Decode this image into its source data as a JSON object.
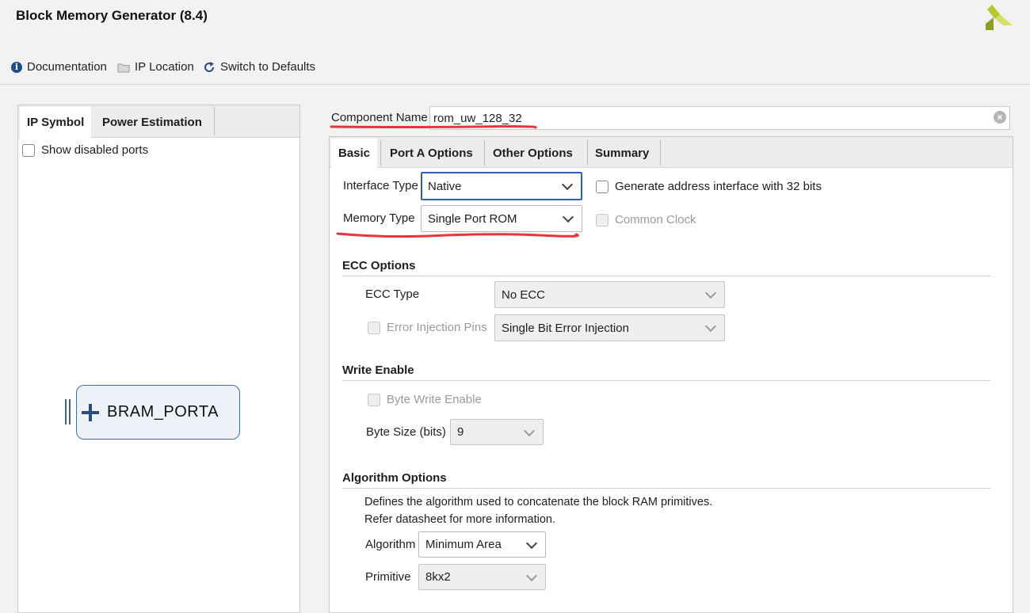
{
  "window": {
    "title": "Block Memory Generator (8.4)"
  },
  "toolbar": {
    "documentation": "Documentation",
    "ip_location": "IP Location",
    "switch_defaults": "Switch to Defaults"
  },
  "left_panel": {
    "tabs": [
      "IP Symbol",
      "Power Estimation"
    ],
    "show_disabled_ports": "Show disabled ports",
    "symbol_label": "BRAM_PORTA"
  },
  "component": {
    "label": "Component Name",
    "value": "rom_uw_128_32"
  },
  "right_tabs": [
    "Basic",
    "Port A Options",
    "Other Options",
    "Summary"
  ],
  "basic": {
    "interface_type_label": "Interface Type",
    "interface_type_value": "Native",
    "memory_type_label": "Memory Type",
    "memory_type_value": "Single Port ROM",
    "gen_addr_label": "Generate address interface with 32 bits",
    "common_clock_label": "Common Clock"
  },
  "ecc": {
    "title": "ECC Options",
    "type_label": "ECC Type",
    "type_value": "No ECC",
    "error_injection_label": "Error Injection Pins",
    "error_injection_value": "Single Bit Error Injection"
  },
  "write_enable": {
    "title": "Write Enable",
    "byte_write_label": "Byte Write Enable",
    "byte_size_label": "Byte Size (bits)",
    "byte_size_value": "9"
  },
  "algorithm": {
    "title": "Algorithm Options",
    "desc_line1": "Defines the algorithm used to concatenate the block RAM primitives.",
    "desc_line2": "Refer datasheet for more information.",
    "algorithm_label": "Algorithm",
    "algorithm_value": "Minimum Area",
    "primitive_label": "Primitive",
    "primitive_value": "8kx2"
  },
  "colors": {
    "accent": "#2b62b5",
    "annotation": "#e8353a",
    "logo": "#b7c92a"
  }
}
